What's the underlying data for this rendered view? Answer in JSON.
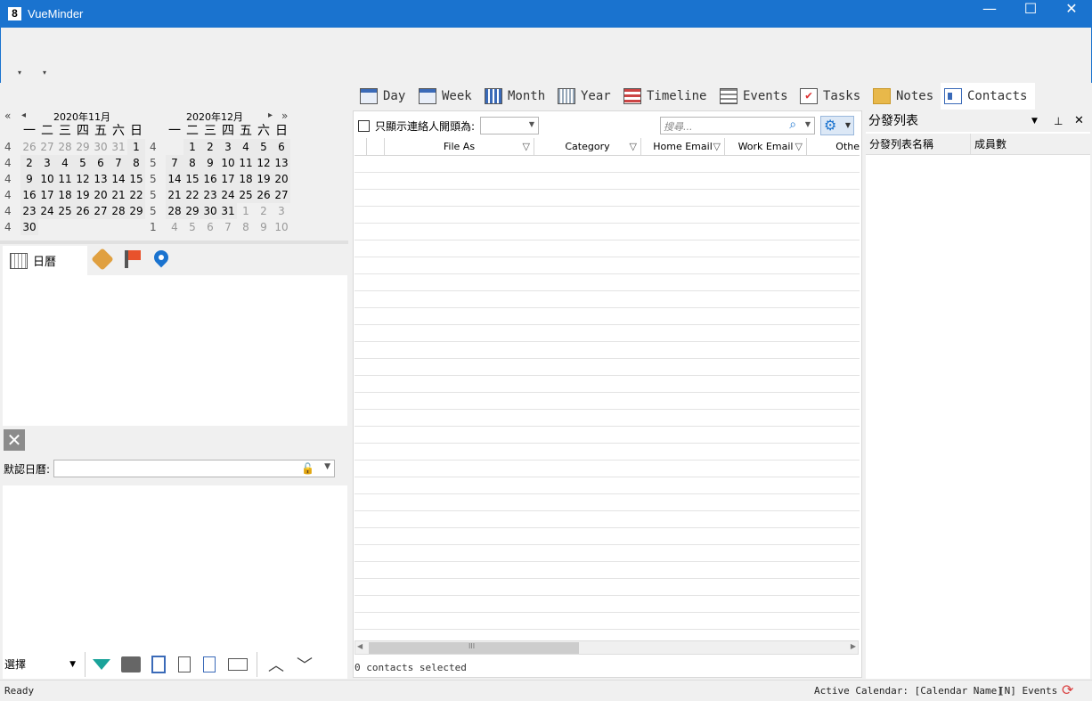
{
  "window": {
    "app_icon": "8",
    "title": "VueMinder",
    "minimize": "—",
    "maximize": "☐",
    "close": "✕"
  },
  "menu": {
    "dropdown1": "▾",
    "dropdown2": "▾"
  },
  "view_tabs": [
    {
      "label": "Day",
      "icon": "day-icon"
    },
    {
      "label": "Week",
      "icon": "week-icon"
    },
    {
      "label": "Month",
      "icon": "month-icon"
    },
    {
      "label": "Year",
      "icon": "year-icon"
    },
    {
      "label": "Timeline",
      "icon": "timeline-icon"
    },
    {
      "label": "Events",
      "icon": "events-icon"
    },
    {
      "label": "Tasks",
      "icon": "tasks-icon"
    },
    {
      "label": "Notes",
      "icon": "notes-icon"
    },
    {
      "label": "Contacts",
      "icon": "contacts-icon",
      "active": true
    }
  ],
  "mini_calendars": {
    "nav_prev_year": "«",
    "nav_prev": "◂",
    "nav_next": "▸",
    "nav_next_year": "»",
    "weekday_headers": [
      "一",
      "二",
      "三",
      "四",
      "五",
      "六",
      "日"
    ],
    "months": [
      {
        "title": "2020年11月",
        "rows": [
          {
            "wk": "4",
            "days": [
              "26",
              "27",
              "28",
              "29",
              "30",
              "31",
              "1"
            ]
          },
          {
            "wk": "4",
            "days": [
              "2",
              "3",
              "4",
              "5",
              "6",
              "7",
              "8"
            ]
          },
          {
            "wk": "4",
            "days": [
              "9",
              "10",
              "11",
              "12",
              "13",
              "14",
              "15"
            ]
          },
          {
            "wk": "4",
            "days": [
              "16",
              "17",
              "18",
              "19",
              "20",
              "21",
              "22"
            ]
          },
          {
            "wk": "4",
            "days": [
              "23",
              "24",
              "25",
              "26",
              "27",
              "28",
              "29"
            ]
          },
          {
            "wk": "4",
            "days": [
              "30",
              "",
              "",
              "",
              "",
              "",
              ""
            ]
          }
        ]
      },
      {
        "title": "2020年12月",
        "rows": [
          {
            "wk": "4",
            "days": [
              "",
              "1",
              "2",
              "3",
              "4",
              "5",
              "6"
            ]
          },
          {
            "wk": "5",
            "days": [
              "7",
              "8",
              "9",
              "10",
              "11",
              "12",
              "13"
            ]
          },
          {
            "wk": "5",
            "days": [
              "14",
              "15",
              "16",
              "17",
              "18",
              "19",
              "20"
            ]
          },
          {
            "wk": "5",
            "days": [
              "21",
              "22",
              "23",
              "24",
              "25",
              "26",
              "27"
            ]
          },
          {
            "wk": "5",
            "days": [
              "28",
              "29",
              "30",
              "31",
              "1",
              "2",
              "3"
            ]
          },
          {
            "wk": "1",
            "days": [
              "4",
              "5",
              "6",
              "7",
              "8",
              "9",
              "10"
            ]
          }
        ]
      }
    ]
  },
  "left_tabs": {
    "calendar_label": "日曆"
  },
  "default_calendar": {
    "label": "默認日曆:",
    "value": ""
  },
  "bottom_toolbar": {
    "select_label": "選擇"
  },
  "contacts": {
    "filter_label": "只顯示連絡人開頭為:",
    "search_placeholder": "搜尋...",
    "columns": [
      "File As",
      "Category",
      "Home Email",
      "Work Email",
      "Othe"
    ],
    "selected_text": "0 contacts selected",
    "scroll_grip": "III"
  },
  "distribution": {
    "title": "分發列表",
    "columns": [
      "分發列表名稱",
      "成員數"
    ]
  },
  "status": {
    "ready": "Ready",
    "active_calendar": "Active Calendar: [Calendar Name]",
    "events": "[N] Events"
  },
  "colors": {
    "titlebar": "#1a73cf",
    "accent": "#1a73cf"
  }
}
